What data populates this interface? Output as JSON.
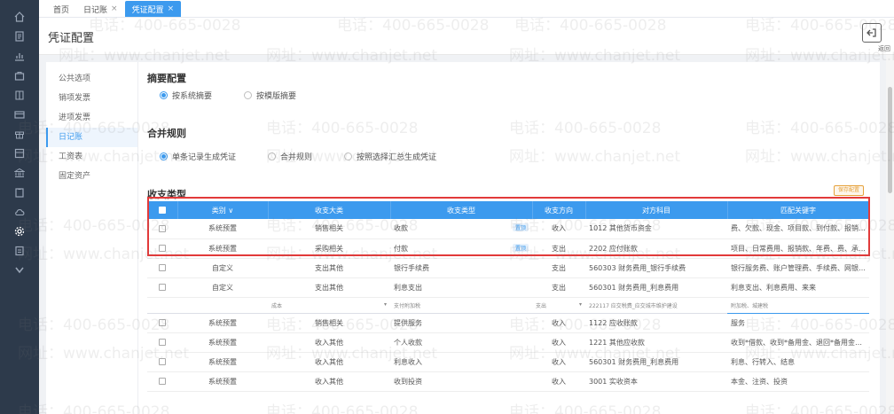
{
  "rail": {
    "items": [
      "home-icon",
      "doc-icon",
      "chart-icon",
      "bag-icon",
      "book-icon",
      "card-icon",
      "gift-icon",
      "box-icon",
      "bank-icon",
      "clipboard-icon",
      "cloud-icon",
      "settings-icon",
      "report-icon",
      "expand-icon"
    ]
  },
  "tabs": [
    {
      "label": "首页",
      "closable": false
    },
    {
      "label": "日记账",
      "closable": true
    },
    {
      "label": "凭证配置",
      "closable": true
    }
  ],
  "header": {
    "title": "凭证配置",
    "back_label": "返回"
  },
  "subnav": [
    "公共选项",
    "销项发票",
    "进项发票",
    "日记账",
    "工资表",
    "固定资产"
  ],
  "summary": {
    "title": "摘要配置",
    "options": [
      "按系统摘要",
      "按模版摘要"
    ],
    "selected": 0
  },
  "merge": {
    "title": "合并规则",
    "options": [
      "单条记录生成凭证",
      "合并规则",
      "按照选择汇总生成凭证"
    ],
    "selected": 0
  },
  "category": {
    "title": "收支类型",
    "save_label": "保存配置"
  },
  "table": {
    "columns": [
      "",
      "类别",
      "收支大类",
      "收支类型",
      "收支方向",
      "对方科目",
      "匹配关键字"
    ],
    "rows": [
      {
        "cat": "系统预置",
        "big": "销售相关",
        "type": "收款",
        "badge": "置顶",
        "dir": "收入",
        "acct": "1012 其他货币资金",
        "kw": "费、欠款、现金、项目款、到付款、报销款、汇入..."
      },
      {
        "cat": "系统预置",
        "big": "采购相关",
        "type": "付款",
        "badge": "置顶",
        "dir": "支出",
        "acct": "2202 应付账款",
        "kw": "项目、日常费用、报销款、年费、费、承兑汇票"
      },
      {
        "cat": "自定义",
        "big": "支出其他",
        "type": "银行手续费",
        "badge": "",
        "dir": "支出",
        "acct": "560303 财务费用_银行手续费",
        "kw": "银行服务费、账户管理费、手续费、网银注册、来来"
      },
      {
        "cat": "自定义",
        "big": "支出其他",
        "type": "利息支出",
        "badge": "",
        "dir": "支出",
        "acct": "560301 财务费用_利息费用",
        "kw": "利息支出、利息费用、来来"
      }
    ],
    "edit_row": {
      "big": "成本",
      "type": "支付附加税",
      "dir": "支出",
      "acct": "222117 应交税费_应交城市维护建设",
      "kw": "附加税、城建税"
    },
    "rows2": [
      {
        "cat": "系统预置",
        "big": "销售相关",
        "type": "提供服务",
        "dir": "收入",
        "acct": "1122 应收账款",
        "kw": "服务"
      },
      {
        "cat": "系统预置",
        "big": "收入其他",
        "type": "个人收款",
        "dir": "收入",
        "acct": "1221 其他应收款",
        "kw": "收到*借款、收到*备用金、退回*备用金、收、个人"
      },
      {
        "cat": "系统预置",
        "big": "收入其他",
        "type": "利息收入",
        "dir": "收入",
        "acct": "560301 财务费用_利息费用",
        "kw": "利息、行转入、结息"
      },
      {
        "cat": "系统预置",
        "big": "收入其他",
        "type": "收到投资",
        "dir": "收入",
        "acct": "3001 实收资本",
        "kw": "本金、注资、投资"
      }
    ]
  },
  "watermark": {
    "phone": "电话：400-665-0028",
    "site": "网址：www.chanjet.net"
  },
  "colors": {
    "accent": "#3c9aee",
    "sidebar": "#2d3a4b",
    "highlight": "#e23a3a"
  }
}
